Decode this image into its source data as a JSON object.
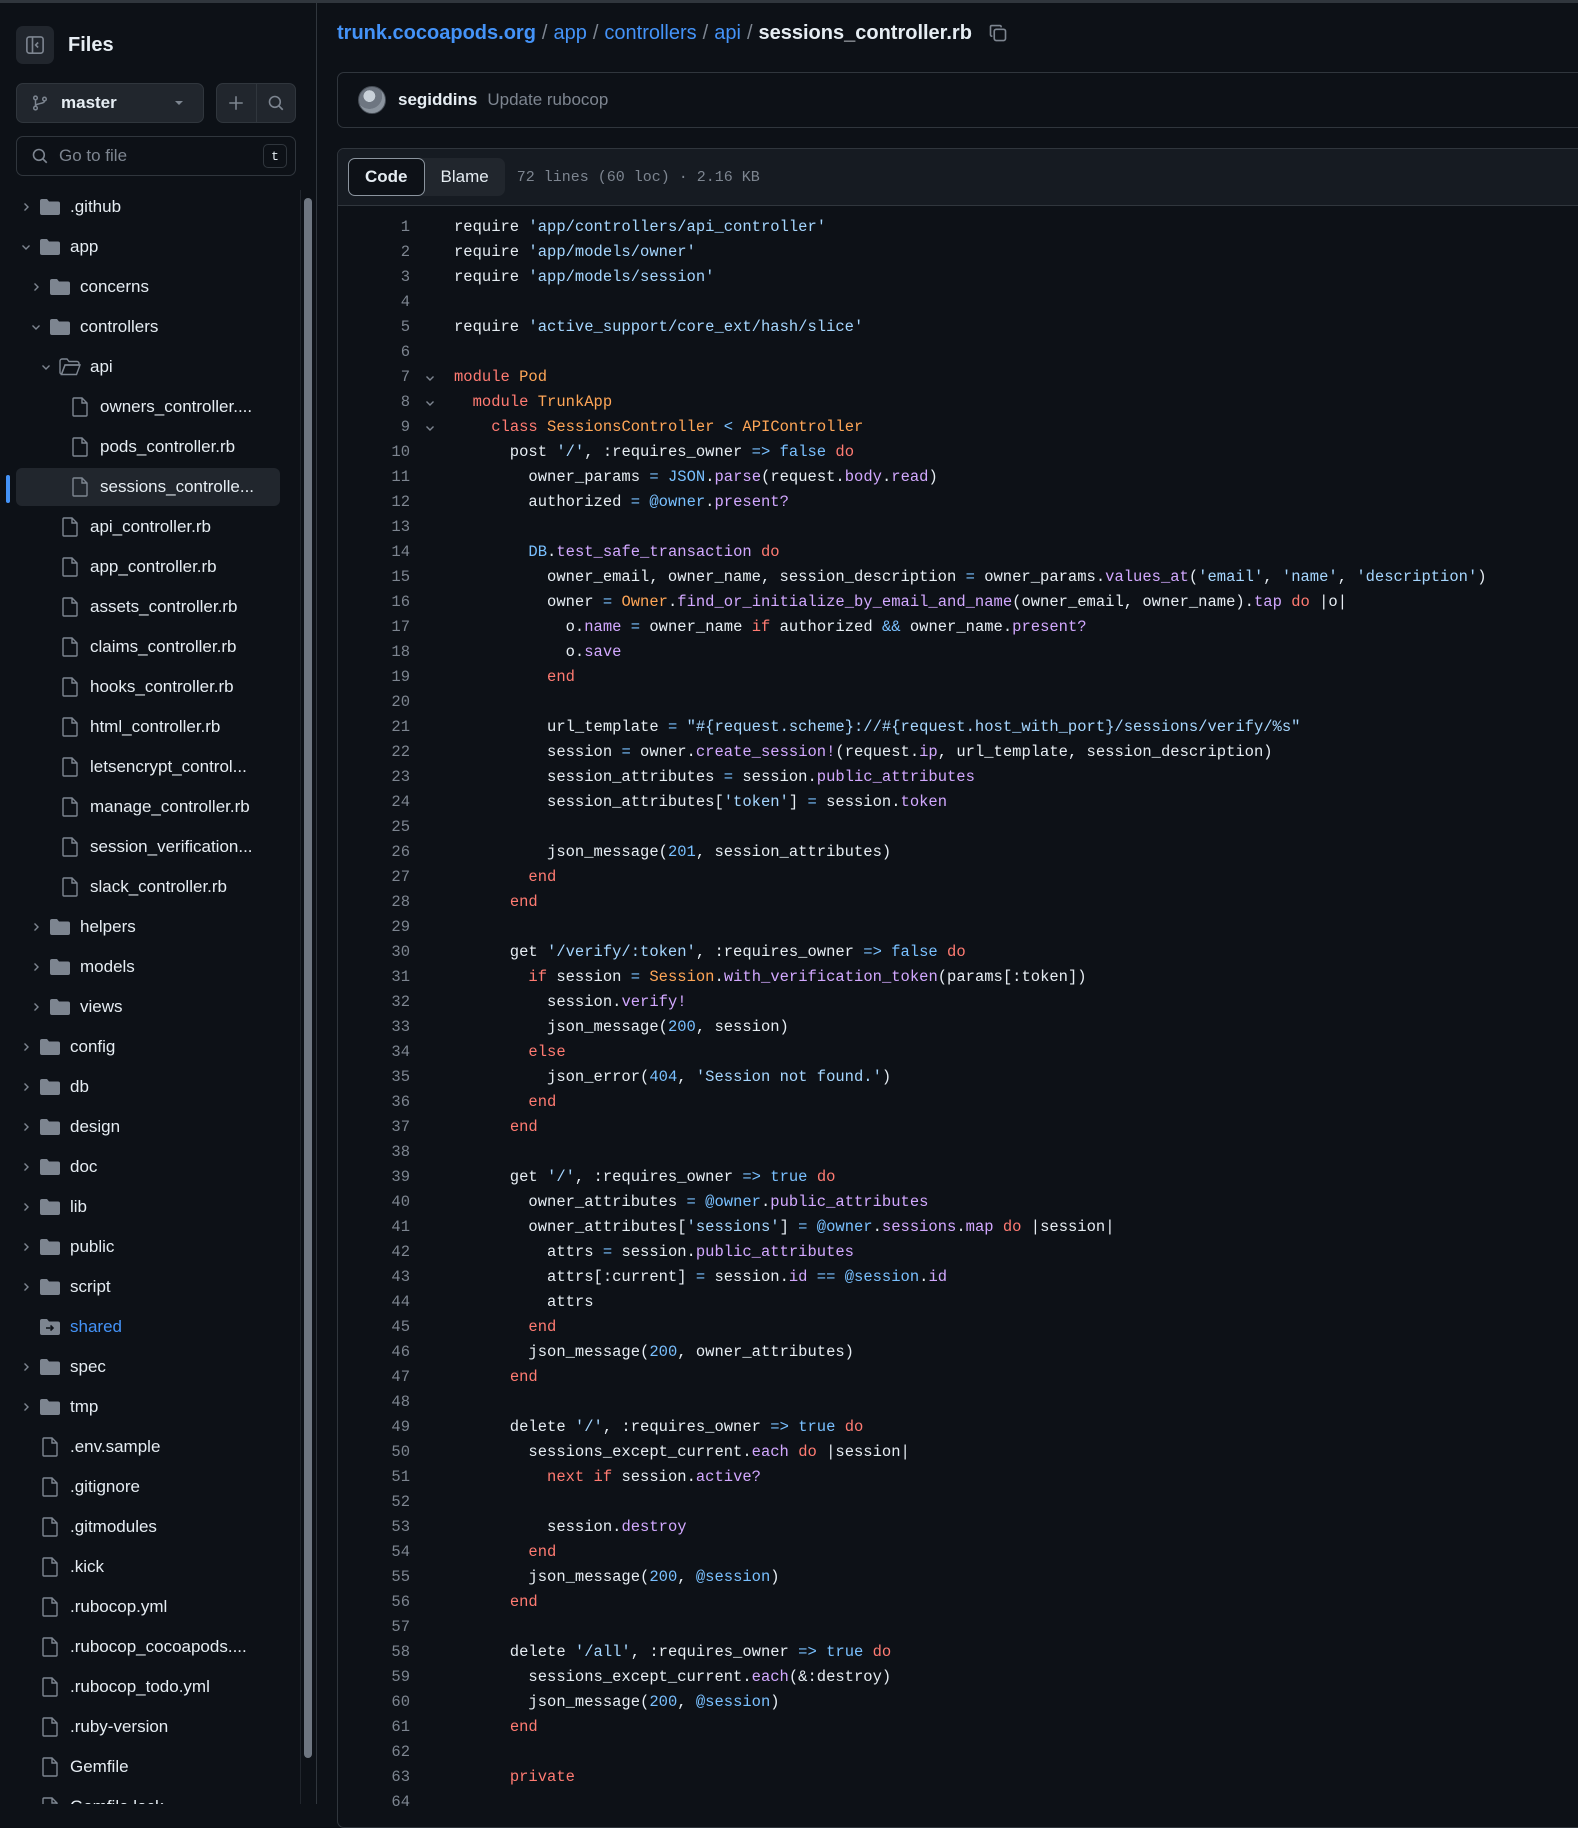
{
  "sidebar": {
    "title": "Files",
    "branch": "master",
    "goto_placeholder": "Go to file",
    "goto_shortcut": "t",
    "tree": [
      {
        "label": ".github",
        "type": "folder",
        "depth": 0,
        "expanded": false
      },
      {
        "label": "app",
        "type": "folder",
        "depth": 0,
        "expanded": true
      },
      {
        "label": "concerns",
        "type": "folder",
        "depth": 1,
        "expanded": false
      },
      {
        "label": "controllers",
        "type": "folder",
        "depth": 1,
        "expanded": true
      },
      {
        "label": "api",
        "type": "folder-open",
        "depth": 2,
        "expanded": true
      },
      {
        "label": "owners_controller....",
        "type": "file",
        "depth": 3
      },
      {
        "label": "pods_controller.rb",
        "type": "file",
        "depth": 3
      },
      {
        "label": "sessions_controlle...",
        "type": "file",
        "depth": 3,
        "selected": true
      },
      {
        "label": "api_controller.rb",
        "type": "file",
        "depth": 2
      },
      {
        "label": "app_controller.rb",
        "type": "file",
        "depth": 2
      },
      {
        "label": "assets_controller.rb",
        "type": "file",
        "depth": 2
      },
      {
        "label": "claims_controller.rb",
        "type": "file",
        "depth": 2
      },
      {
        "label": "hooks_controller.rb",
        "type": "file",
        "depth": 2
      },
      {
        "label": "html_controller.rb",
        "type": "file",
        "depth": 2
      },
      {
        "label": "letsencrypt_control...",
        "type": "file",
        "depth": 2
      },
      {
        "label": "manage_controller.rb",
        "type": "file",
        "depth": 2
      },
      {
        "label": "session_verification...",
        "type": "file",
        "depth": 2
      },
      {
        "label": "slack_controller.rb",
        "type": "file",
        "depth": 2
      },
      {
        "label": "helpers",
        "type": "folder",
        "depth": 1,
        "expanded": false
      },
      {
        "label": "models",
        "type": "folder",
        "depth": 1,
        "expanded": false
      },
      {
        "label": "views",
        "type": "folder",
        "depth": 1,
        "expanded": false
      },
      {
        "label": "config",
        "type": "folder",
        "depth": 0,
        "expanded": false
      },
      {
        "label": "db",
        "type": "folder",
        "depth": 0,
        "expanded": false
      },
      {
        "label": "design",
        "type": "folder",
        "depth": 0,
        "expanded": false
      },
      {
        "label": "doc",
        "type": "folder",
        "depth": 0,
        "expanded": false
      },
      {
        "label": "lib",
        "type": "folder",
        "depth": 0,
        "expanded": false
      },
      {
        "label": "public",
        "type": "folder",
        "depth": 0,
        "expanded": false
      },
      {
        "label": "script",
        "type": "folder",
        "depth": 0,
        "expanded": false
      },
      {
        "label": "shared",
        "type": "submodule",
        "depth": 0
      },
      {
        "label": "spec",
        "type": "folder",
        "depth": 0,
        "expanded": false
      },
      {
        "label": "tmp",
        "type": "folder",
        "depth": 0,
        "expanded": false
      },
      {
        "label": ".env.sample",
        "type": "file",
        "depth": 0
      },
      {
        "label": ".gitignore",
        "type": "file",
        "depth": 0
      },
      {
        "label": ".gitmodules",
        "type": "file",
        "depth": 0
      },
      {
        "label": ".kick",
        "type": "file",
        "depth": 0
      },
      {
        "label": ".rubocop.yml",
        "type": "file",
        "depth": 0
      },
      {
        "label": ".rubocop_cocoapods....",
        "type": "file",
        "depth": 0
      },
      {
        "label": ".rubocop_todo.yml",
        "type": "file",
        "depth": 0
      },
      {
        "label": ".ruby-version",
        "type": "file",
        "depth": 0
      },
      {
        "label": "Gemfile",
        "type": "file",
        "depth": 0
      },
      {
        "label": "Gemfile.lock",
        "type": "file",
        "depth": 0
      }
    ]
  },
  "breadcrumb": {
    "repo": "trunk.cocoapods.org",
    "parts": [
      "app",
      "controllers",
      "api"
    ],
    "file": "sessions_controller.rb"
  },
  "commit": {
    "author": "segiddins",
    "message": "Update rubocop"
  },
  "code_header": {
    "tab_code": "Code",
    "tab_blame": "Blame",
    "file_info": "72 lines (60 loc) · 2.16 KB"
  },
  "colors": {
    "keyword": "#ff7b72",
    "string": "#a5d6ff",
    "constant": "#ffa657",
    "method": "#d2a8ff",
    "number": "#79c0ff",
    "accent": "#4493f8"
  },
  "code": {
    "fold_lines": [
      7,
      8,
      9
    ],
    "lines": [
      "require 'app/controllers/api_controller'",
      "require 'app/models/owner'",
      "require 'app/models/session'",
      "",
      "require 'active_support/core_ext/hash/slice'",
      "",
      "module Pod",
      "  module TrunkApp",
      "    class SessionsController < APIController",
      "      post '/', :requires_owner => false do",
      "        owner_params = JSON.parse(request.body.read)",
      "        authorized = @owner.present?",
      "",
      "        DB.test_safe_transaction do",
      "          owner_email, owner_name, session_description = owner_params.values_at('email', 'name', 'description')",
      "          owner = Owner.find_or_initialize_by_email_and_name(owner_email, owner_name).tap do |o|",
      "            o.name = owner_name if authorized && owner_name.present?",
      "            o.save",
      "          end",
      "",
      "          url_template = \"#{request.scheme}://#{request.host_with_port}/sessions/verify/%s\"",
      "          session = owner.create_session!(request.ip, url_template, session_description)",
      "          session_attributes = session.public_attributes",
      "          session_attributes['token'] = session.token",
      "",
      "          json_message(201, session_attributes)",
      "        end",
      "      end",
      "",
      "      get '/verify/:token', :requires_owner => false do",
      "        if session = Session.with_verification_token(params[:token])",
      "          session.verify!",
      "          json_message(200, session)",
      "        else",
      "          json_error(404, 'Session not found.')",
      "        end",
      "      end",
      "",
      "      get '/', :requires_owner => true do",
      "        owner_attributes = @owner.public_attributes",
      "        owner_attributes['sessions'] = @owner.sessions.map do |session|",
      "          attrs = session.public_attributes",
      "          attrs[:current] = session.id == @session.id",
      "          attrs",
      "        end",
      "        json_message(200, owner_attributes)",
      "      end",
      "",
      "      delete '/', :requires_owner => true do",
      "        sessions_except_current.each do |session|",
      "          next if session.active?",
      "",
      "          session.destroy",
      "        end",
      "        json_message(200, @session)",
      "      end",
      "",
      "      delete '/all', :requires_owner => true do",
      "        sessions_except_current.each(&:destroy)",
      "        json_message(200, @session)",
      "      end",
      "",
      "      private",
      ""
    ]
  }
}
